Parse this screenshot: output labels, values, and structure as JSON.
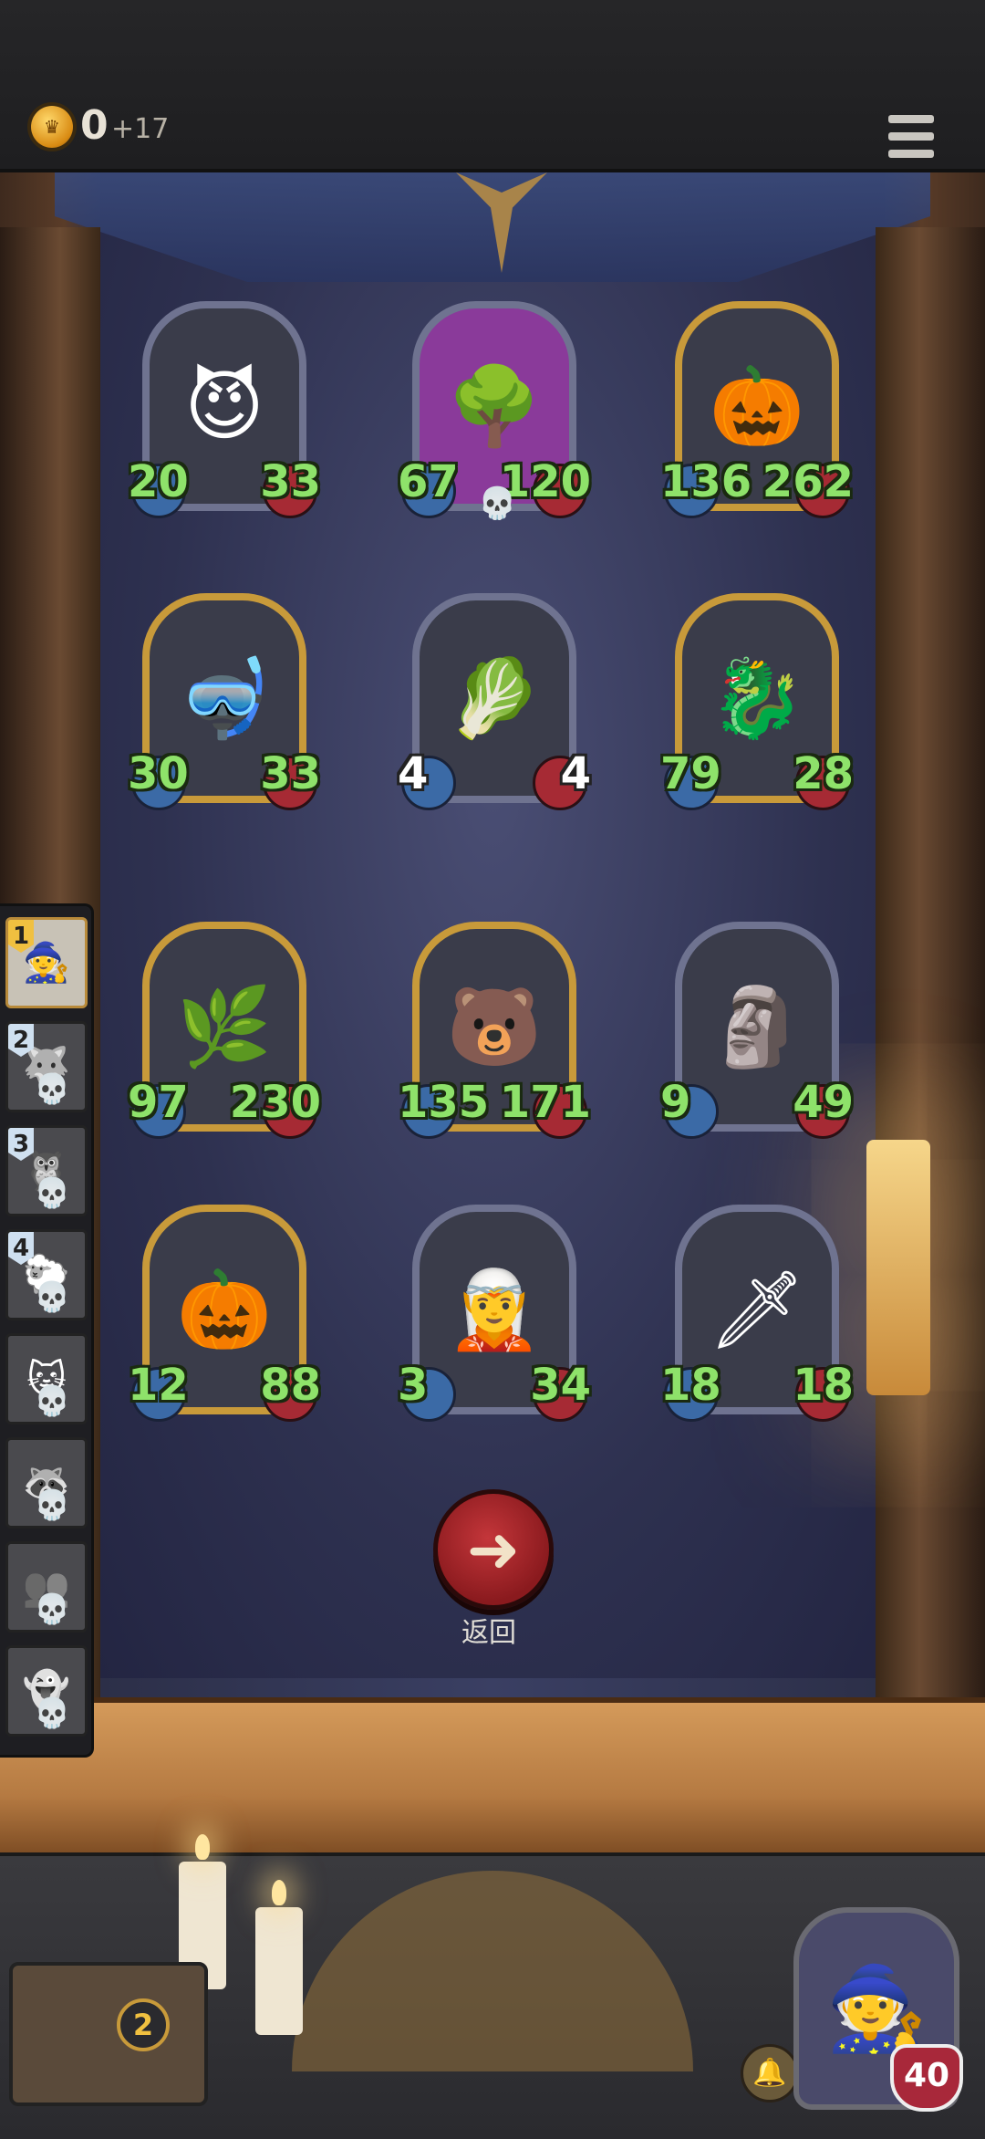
{
  "top_bar": {
    "gold": "0",
    "gold_delta": "+17",
    "coin_icon": "crown-coin-icon",
    "menu_icon": "menu-icon"
  },
  "cards": [
    {
      "name": "green-grin-monster",
      "atk": "20",
      "hp": "33",
      "frame": "silver",
      "emoji": "😈"
    },
    {
      "name": "purple-tree-ent",
      "atk": "67",
      "hp": "120",
      "frame": "silver",
      "bg": "purple",
      "emoji": "🌳",
      "skull": true
    },
    {
      "name": "pumpkin-stack",
      "atk": "136",
      "hp": "262",
      "frame": "gold",
      "emoji": "🎃"
    },
    {
      "name": "diver-helmet-brute",
      "atk": "30",
      "hp": "33",
      "frame": "gold",
      "emoji": "🤿"
    },
    {
      "name": "angry-radish",
      "atk": "4",
      "hp": "4",
      "frame": "silver",
      "emoji": "🥬",
      "white": true
    },
    {
      "name": "purple-dragon",
      "atk": "79",
      "hp": "28",
      "frame": "gold",
      "emoji": "🐉"
    },
    {
      "name": "leaf-haired-girl",
      "atk": "97",
      "hp": "230",
      "frame": "gold",
      "emoji": "🌿"
    },
    {
      "name": "hooded-bear",
      "atk": "135",
      "hp": "171",
      "frame": "gold",
      "emoji": "🐻"
    },
    {
      "name": "stone-golem",
      "atk": "9",
      "hp": "49",
      "frame": "silver",
      "emoji": "🗿"
    },
    {
      "name": "pumpkin-leaf-sprite",
      "atk": "12",
      "hp": "88",
      "frame": "gold",
      "emoji": "🎃"
    },
    {
      "name": "blue-hat-elf",
      "atk": "3",
      "hp": "34",
      "frame": "silver",
      "emoji": "🧝"
    },
    {
      "name": "cursed-sword",
      "atk": "18",
      "hp": "18",
      "frame": "silver",
      "emoji": "🗡"
    }
  ],
  "back_button": {
    "label": "返回",
    "icon": "arrow-left-icon"
  },
  "sidebar": [
    {
      "num": "1",
      "emoji": "🧙",
      "active": true
    },
    {
      "num": "2",
      "emoji": "🐺"
    },
    {
      "num": "3",
      "emoji": "🦉"
    },
    {
      "num": "4",
      "emoji": "🐑"
    },
    {
      "num": "",
      "emoji": "🐱"
    },
    {
      "num": "",
      "emoji": "🦝"
    },
    {
      "num": "",
      "emoji": "👥"
    },
    {
      "num": "",
      "emoji": "👻"
    }
  ],
  "bottom": {
    "deck_count": "2",
    "hero_hp": "40",
    "bell_icon": "bell-icon"
  }
}
